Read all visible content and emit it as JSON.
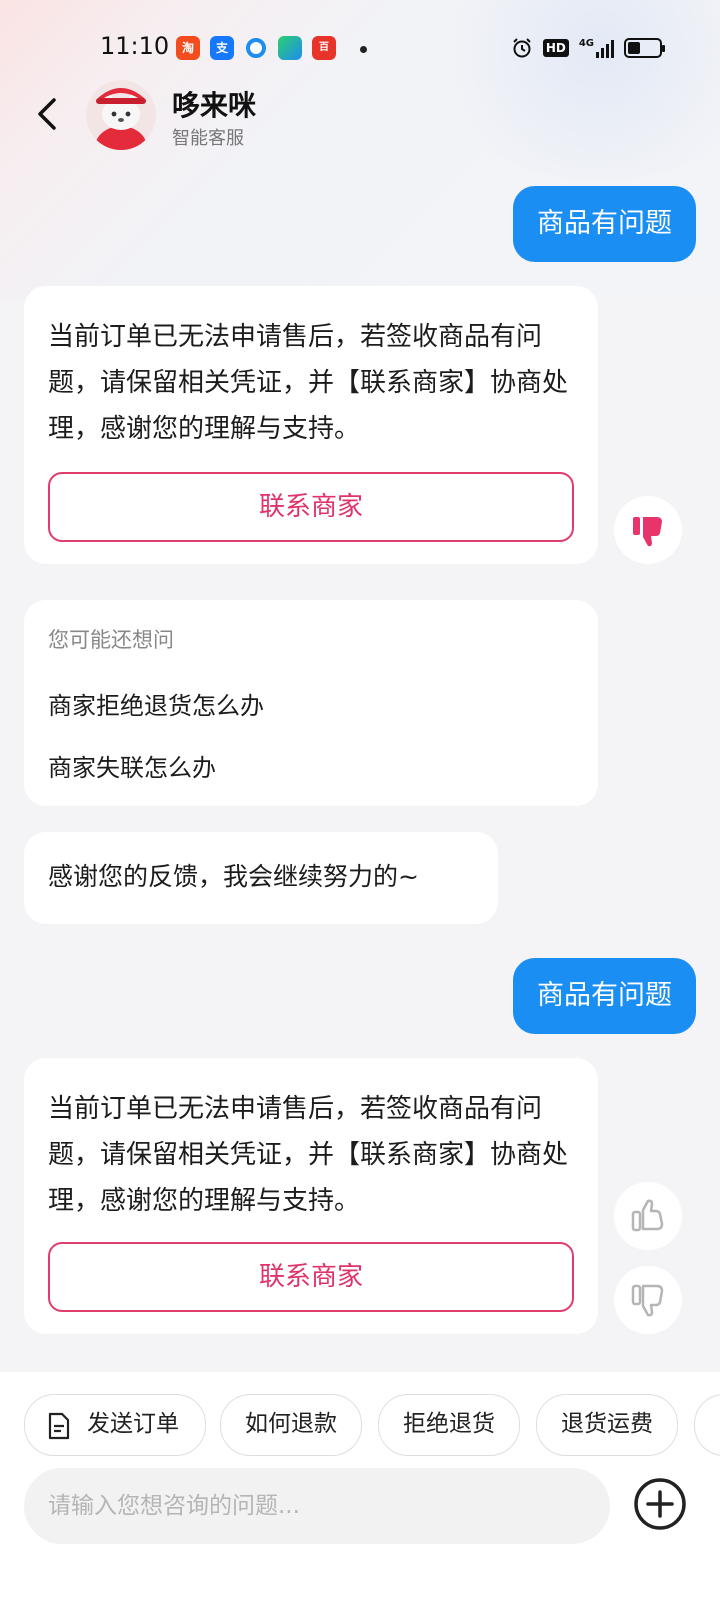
{
  "status_bar": {
    "time": "11:10",
    "apps": [
      "淘",
      "支",
      "",
      "",
      "百"
    ],
    "right_icons": [
      "alarm-icon",
      "hd-icon",
      "4g-signal-icon",
      "battery-icon"
    ],
    "network": "4G",
    "hd": "HD"
  },
  "header": {
    "name": "哆来咪",
    "subtitle": "智能客服"
  },
  "messages": {
    "user_1": "商品有问题",
    "bot_1_text": "当前订单已无法申请售后，若签收商品有问题，请保留相关凭证，并【联系商家】协商处理，感谢您的理解与支持。",
    "bot_1_button": "联系商家",
    "suggest_title": "您可能还想问",
    "suggest_items": [
      "商家拒绝退货怎么办",
      "商家失联怎么办"
    ],
    "bot_thanks": "感谢您的反馈，我会继续努力的~",
    "user_2": "商品有问题",
    "bot_2_text": "当前订单已无法申请售后，若签收商品有问题，请保留相关凭证，并【联系商家】协商处理，感谢您的理解与支持。",
    "bot_2_button": "联系商家"
  },
  "quick_chips": [
    "发送订单",
    "如何退款",
    "拒绝退货",
    "退货运费"
  ],
  "input": {
    "placeholder": "请输入您想咨询的问题..."
  },
  "colors": {
    "accent_blue": "#1a8ef2",
    "accent_pink": "#e0336a"
  }
}
